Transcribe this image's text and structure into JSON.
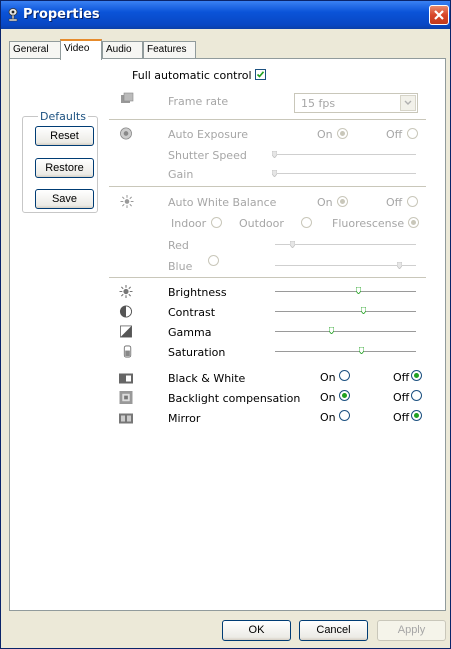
{
  "window": {
    "title": "Properties"
  },
  "tabs": [
    {
      "label": "General"
    },
    {
      "label": "Video"
    },
    {
      "label": "Audio"
    },
    {
      "label": "Features"
    }
  ],
  "full_auto": {
    "label": "Full automatic control",
    "checked": true
  },
  "defaults": {
    "title": "Defaults",
    "reset": "Reset",
    "restore": "Restore",
    "save": "Save"
  },
  "frame_rate": {
    "label": "Frame rate",
    "value": "15 fps"
  },
  "exposure": {
    "label": "Auto Exposure",
    "on": "On",
    "off": "Off",
    "selected": "On",
    "shutter_label": "Shutter Speed",
    "gain_label": "Gain"
  },
  "white_balance": {
    "label": "Auto White Balance",
    "on": "On",
    "off": "Off",
    "selected": "On",
    "indoor": "Indoor",
    "outdoor": "Outdoor",
    "fluorescense": "Fluorescense",
    "selected_preset": "Fluorescense",
    "red_label": "Red",
    "blue_label": "Blue"
  },
  "adjust": {
    "brightness": {
      "label": "Brightness",
      "value": 0.59
    },
    "contrast": {
      "label": "Contrast",
      "value": 0.63
    },
    "gamma": {
      "label": "Gamma",
      "value": 0.4
    },
    "saturation": {
      "label": "Saturation",
      "value": 0.61
    }
  },
  "toggles": {
    "bw": {
      "label": "Black & White",
      "on": "On",
      "off": "Off",
      "selected": "Off"
    },
    "backlight": {
      "label": "Backlight compensation",
      "on": "On",
      "off": "Off",
      "selected": "On"
    },
    "mirror": {
      "label": "Mirror",
      "on": "On",
      "off": "Off",
      "selected": "Off"
    }
  },
  "footer": {
    "ok": "OK",
    "cancel": "Cancel",
    "apply": "Apply"
  }
}
